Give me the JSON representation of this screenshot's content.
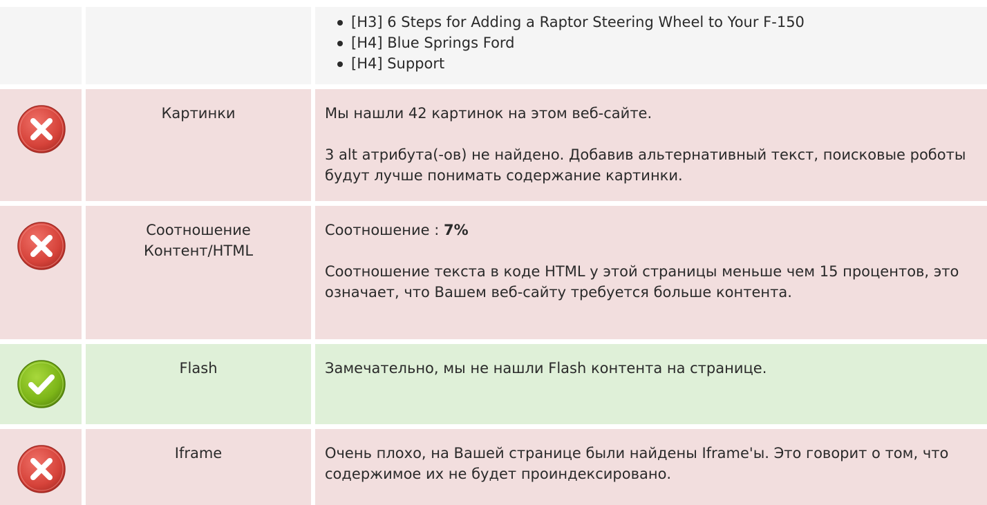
{
  "headings_row": {
    "items": [
      "[H3] 6 Steps for Adding a Raptor Steering Wheel to Your F-150",
      "[H4] Blue Springs Ford",
      "[H4] Support"
    ]
  },
  "rows": [
    {
      "status": "error",
      "name": "Картинки",
      "paragraphs": [
        "Мы нашли 42 картинок на этом веб-сайте.",
        "3 alt атрибута(-ов) не найдено. Добавив альтернативный текст, поисковые роботы будут лучше понимать содержание картинки."
      ]
    },
    {
      "status": "error",
      "name": "Соотношение Контент/HTML",
      "ratio_label": "Соотношение : ",
      "ratio_value": "7%",
      "paragraphs": [
        "Соотношение текста в коде HTML у этой страницы меньше чем 15 процентов, это означает, что Вашем веб-сайту требуется больше контента."
      ]
    },
    {
      "status": "ok",
      "name": "Flash",
      "paragraphs": [
        "Замечательно, мы не нашли Flash контента на странице."
      ]
    },
    {
      "status": "error",
      "name": "Iframe",
      "paragraphs": [
        "Очень плохо, на Вашей странице были найдены Iframe'ы. Это говорит о том, что содержимое их не будет проиндексировано."
      ]
    }
  ],
  "colors": {
    "error_bg": "#f2dede",
    "ok_bg": "#dff0d8",
    "neutral_bg": "#f5f5f5",
    "error_icon": "#d9534f",
    "ok_icon": "#7cb518"
  },
  "icons": {
    "error": "x-circle-icon",
    "ok": "check-circle-icon"
  }
}
